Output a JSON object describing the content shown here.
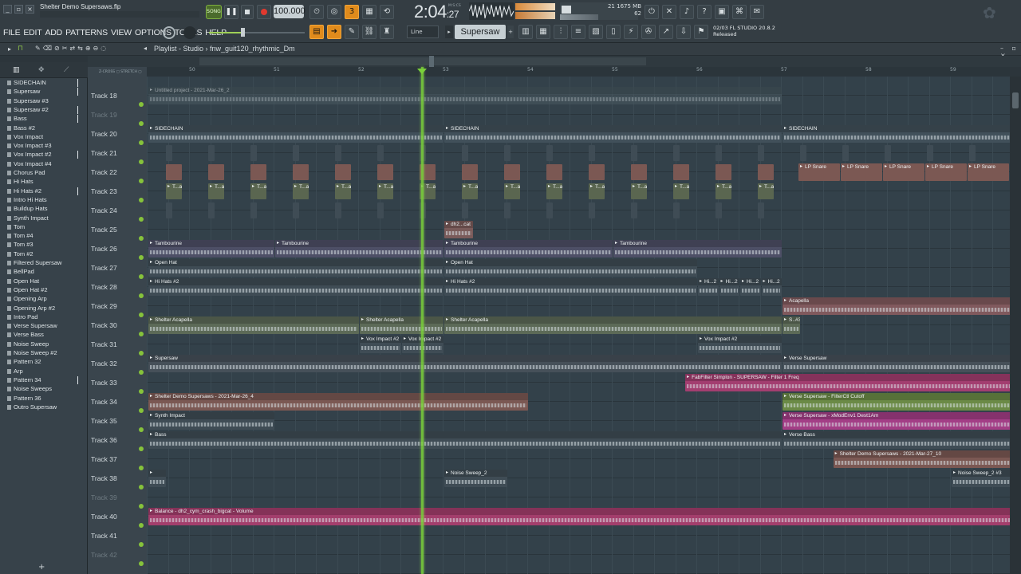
{
  "window": {
    "title": "Shelter Demo Supersaws.flp"
  },
  "menu": [
    "FILE",
    "EDIT",
    "ADD",
    "PATTERNS",
    "VIEW",
    "OPTIONS",
    "TOOLS",
    "HELP"
  ],
  "transport": {
    "song_label": "SONG",
    "tempo": "100.000",
    "time_main": "2:04",
    "time_sub": ":27",
    "time_unit": "M:S:CS"
  },
  "cpu": {
    "value": "21",
    "memory": "1675 MB",
    "polyphony": "62"
  },
  "tool_mode": "Line",
  "pattern_selected": "Supersaw",
  "hint": {
    "line1": "02/03  FL STUDIO 20.8.2",
    "line2": "Released"
  },
  "playlist": {
    "label": "Playlist - Studio",
    "arrangement": "fnw_guit120_rhythmic_Dm"
  },
  "ruler": [
    "50",
    "51",
    "52",
    "53",
    "54",
    "55",
    "56",
    "57",
    "58",
    "59"
  ],
  "browser": [
    "SIDECHAIN",
    "Supersaw",
    "Supersaw #3",
    "Supersaw #2",
    "Bass",
    "Bass #2",
    "Vox Impact",
    "Vox Impact #3",
    "Vox Impact #2",
    "Vox Impact #4",
    "Chorus Pad",
    "Hi Hats",
    "Hi Hats #2",
    "Intro Hi Hats",
    "Buildup Hats",
    "Synth Impact",
    "Tom",
    "Tom #4",
    "Tom #3",
    "Tom #2",
    "Filtered Supersaw",
    "BellPad",
    "Open Hat",
    "Open Hat #2",
    "Opening Arp",
    "Opening Arp #2",
    "Intro Pad",
    "Verse Supersaw",
    "Verse Bass",
    "Noise Sweep",
    "Noise Sweep #2",
    "Pattern 32",
    "Arp",
    "Pattern 34",
    "Noise Sweeps",
    "Pattern 36",
    "Outro Supersaw"
  ],
  "tracks": [
    {
      "name": "Track 18",
      "dim": false
    },
    {
      "name": "Track 19",
      "dim": true
    },
    {
      "name": "Track 20",
      "dim": false
    },
    {
      "name": "Track 21",
      "dim": false
    },
    {
      "name": "Track 22",
      "dim": false
    },
    {
      "name": "Track 23",
      "dim": false
    },
    {
      "name": "Track 24",
      "dim": false
    },
    {
      "name": "Track 25",
      "dim": false
    },
    {
      "name": "Track 26",
      "dim": false
    },
    {
      "name": "Track 27",
      "dim": false
    },
    {
      "name": "Track 28",
      "dim": false
    },
    {
      "name": "Track 29",
      "dim": false
    },
    {
      "name": "Track 30",
      "dim": false
    },
    {
      "name": "Track 31",
      "dim": false
    },
    {
      "name": "Track 32",
      "dim": false
    },
    {
      "name": "Track 33",
      "dim": false
    },
    {
      "name": "Track 34",
      "dim": false
    },
    {
      "name": "Track 35",
      "dim": false
    },
    {
      "name": "Track 36",
      "dim": false
    },
    {
      "name": "Track 37",
      "dim": false
    },
    {
      "name": "Track 38",
      "dim": false
    },
    {
      "name": "Track 39",
      "dim": true
    },
    {
      "name": "Track 40",
      "dim": false
    },
    {
      "name": "Track 41",
      "dim": false
    },
    {
      "name": "Track 42",
      "dim": true
    }
  ],
  "clips": [
    {
      "row": 0,
      "start": 0,
      "end": 7.5,
      "label": "Untitled project - 2021-Mar-26_2",
      "color": "#4a5961",
      "dim": true
    },
    {
      "row": 2,
      "start": 0,
      "end": 3.5,
      "label": "SIDECHAIN",
      "color": "#41505a"
    },
    {
      "row": 2,
      "start": 3.5,
      "end": 7.5,
      "label": "SIDECHAIN",
      "color": "#41505a"
    },
    {
      "row": 2,
      "start": 7.5,
      "end": 10.5,
      "label": "SIDECHAIN",
      "color": "#41505a"
    },
    {
      "row": 7,
      "start": 3.5,
      "end": 3.85,
      "label": "dh2...cat",
      "color": "#7a5b5a"
    },
    {
      "row": 8,
      "start": 0,
      "end": 1.5,
      "label": "Tambourine",
      "color": "#4d4f66"
    },
    {
      "row": 8,
      "start": 1.5,
      "end": 3.5,
      "label": "Tambourine",
      "color": "#4d4f66"
    },
    {
      "row": 8,
      "start": 3.5,
      "end": 5.5,
      "label": "Tambourine",
      "color": "#4d4f66"
    },
    {
      "row": 8,
      "start": 5.5,
      "end": 7.5,
      "label": "Tambourine",
      "color": "#4d4f66"
    },
    {
      "row": 9,
      "start": 0,
      "end": 3.5,
      "label": "Open Hat",
      "color": "#3f4c55"
    },
    {
      "row": 9,
      "start": 3.5,
      "end": 6.5,
      "label": "Open Hat",
      "color": "#3f4c55"
    },
    {
      "row": 10,
      "start": 0,
      "end": 3.5,
      "label": "Hi Hats #2",
      "color": "#3f4c55"
    },
    {
      "row": 10,
      "start": 3.5,
      "end": 6.5,
      "label": "Hi Hats #2",
      "color": "#3f4c55"
    },
    {
      "row": 10,
      "start": 6.5,
      "end": 6.75,
      "label": "Hi...2",
      "color": "#3f4c55"
    },
    {
      "row": 10,
      "start": 6.75,
      "end": 7.0,
      "label": "Hi...2",
      "color": "#3f4c55"
    },
    {
      "row": 10,
      "start": 7.0,
      "end": 7.25,
      "label": "Hi...2",
      "color": "#3f4c55"
    },
    {
      "row": 10,
      "start": 7.25,
      "end": 7.5,
      "label": "Hi...2",
      "color": "#3f4c55"
    },
    {
      "row": 11,
      "start": 7.5,
      "end": 10.5,
      "label": "Acapella",
      "color": "#80595d"
    },
    {
      "row": 12,
      "start": 0,
      "end": 2.5,
      "label": "Shelter Acapella",
      "color": "#5c6a57"
    },
    {
      "row": 12,
      "start": 2.5,
      "end": 3.5,
      "label": "Shelter Acapella",
      "color": "#5c6a57"
    },
    {
      "row": 12,
      "start": 3.5,
      "end": 7.5,
      "label": "Shelter Acapella",
      "color": "#5c6a57"
    },
    {
      "row": 12,
      "start": 7.5,
      "end": 7.72,
      "label": "S..#3",
      "color": "#5c6a57"
    },
    {
      "row": 13,
      "start": 2.5,
      "end": 3.0,
      "label": "Vox Impact #2",
      "color": "#3f4c55"
    },
    {
      "row": 13,
      "start": 3.0,
      "end": 3.5,
      "label": "Vox Impact #2",
      "color": "#3f4c55"
    },
    {
      "row": 13,
      "start": 6.5,
      "end": 7.5,
      "label": "Vox Impact #2",
      "color": "#3f4c55"
    },
    {
      "row": 14,
      "start": 0,
      "end": 7.5,
      "label": "Supersaw",
      "color": "#465059"
    },
    {
      "row": 14,
      "start": 7.5,
      "end": 10.5,
      "label": "Verse Supersaw",
      "color": "#465059"
    },
    {
      "row": 15,
      "start": 6.35,
      "end": 10.5,
      "label": "FabFilter Simplon - SUPERSAW - Filter 1 Freq",
      "color": "#a33e70"
    },
    {
      "row": 16,
      "start": 0,
      "end": 4.5,
      "label": "Shelter Demo Supersaws - 2021-Mar-26_4",
      "color": "#7b5853"
    },
    {
      "row": 16,
      "start": 7.5,
      "end": 10.5,
      "label": "Verse Supersaw - FilterCtl Cutoff",
      "color": "#6b8a46"
    },
    {
      "row": 17,
      "start": 0,
      "end": 1.5,
      "label": "Synth Impact",
      "color": "#3f4c55"
    },
    {
      "row": 17,
      "start": 7.5,
      "end": 10.5,
      "label": "Verse Supersaw - xModEnv1 Dest1Am",
      "color": "#a33e86"
    },
    {
      "row": 18,
      "start": 0,
      "end": 7.5,
      "label": "Bass",
      "color": "#3f4c55"
    },
    {
      "row": 18,
      "start": 7.5,
      "end": 10.5,
      "label": "Verse Bass",
      "color": "#3f4c55"
    },
    {
      "row": 19,
      "start": 8.1,
      "end": 10.5,
      "label": "Shelter Demo Supersaws - 2021-Mar-27_10",
      "color": "#7b5853"
    },
    {
      "row": 20,
      "start": 0,
      "end": 0.22,
      "label": "",
      "color": "#3f4c55"
    },
    {
      "row": 20,
      "start": 3.5,
      "end": 4.25,
      "label": "Noise Sweep_2",
      "color": "#3f4c55"
    },
    {
      "row": 20,
      "start": 9.5,
      "end": 10.5,
      "label": "Noise Sweep_2 #3",
      "color": "#3f4c55"
    },
    {
      "row": 22,
      "start": 0,
      "end": 10.5,
      "label": "Balance - dh2_cym_crash_bigcat - Volume",
      "color": "#a33e6c"
    }
  ],
  "pattern_rows": [
    {
      "row": 3,
      "label": "",
      "color": "#3f4c55"
    },
    {
      "row": 4,
      "label": "",
      "color": "#7b5853",
      "snare_from": 7.5,
      "snare_label": "LP Snare"
    },
    {
      "row": 5,
      "label": "T...ap",
      "color": "#5a6650"
    },
    {
      "row": 6,
      "label": "",
      "color": "#3f4c55"
    }
  ]
}
